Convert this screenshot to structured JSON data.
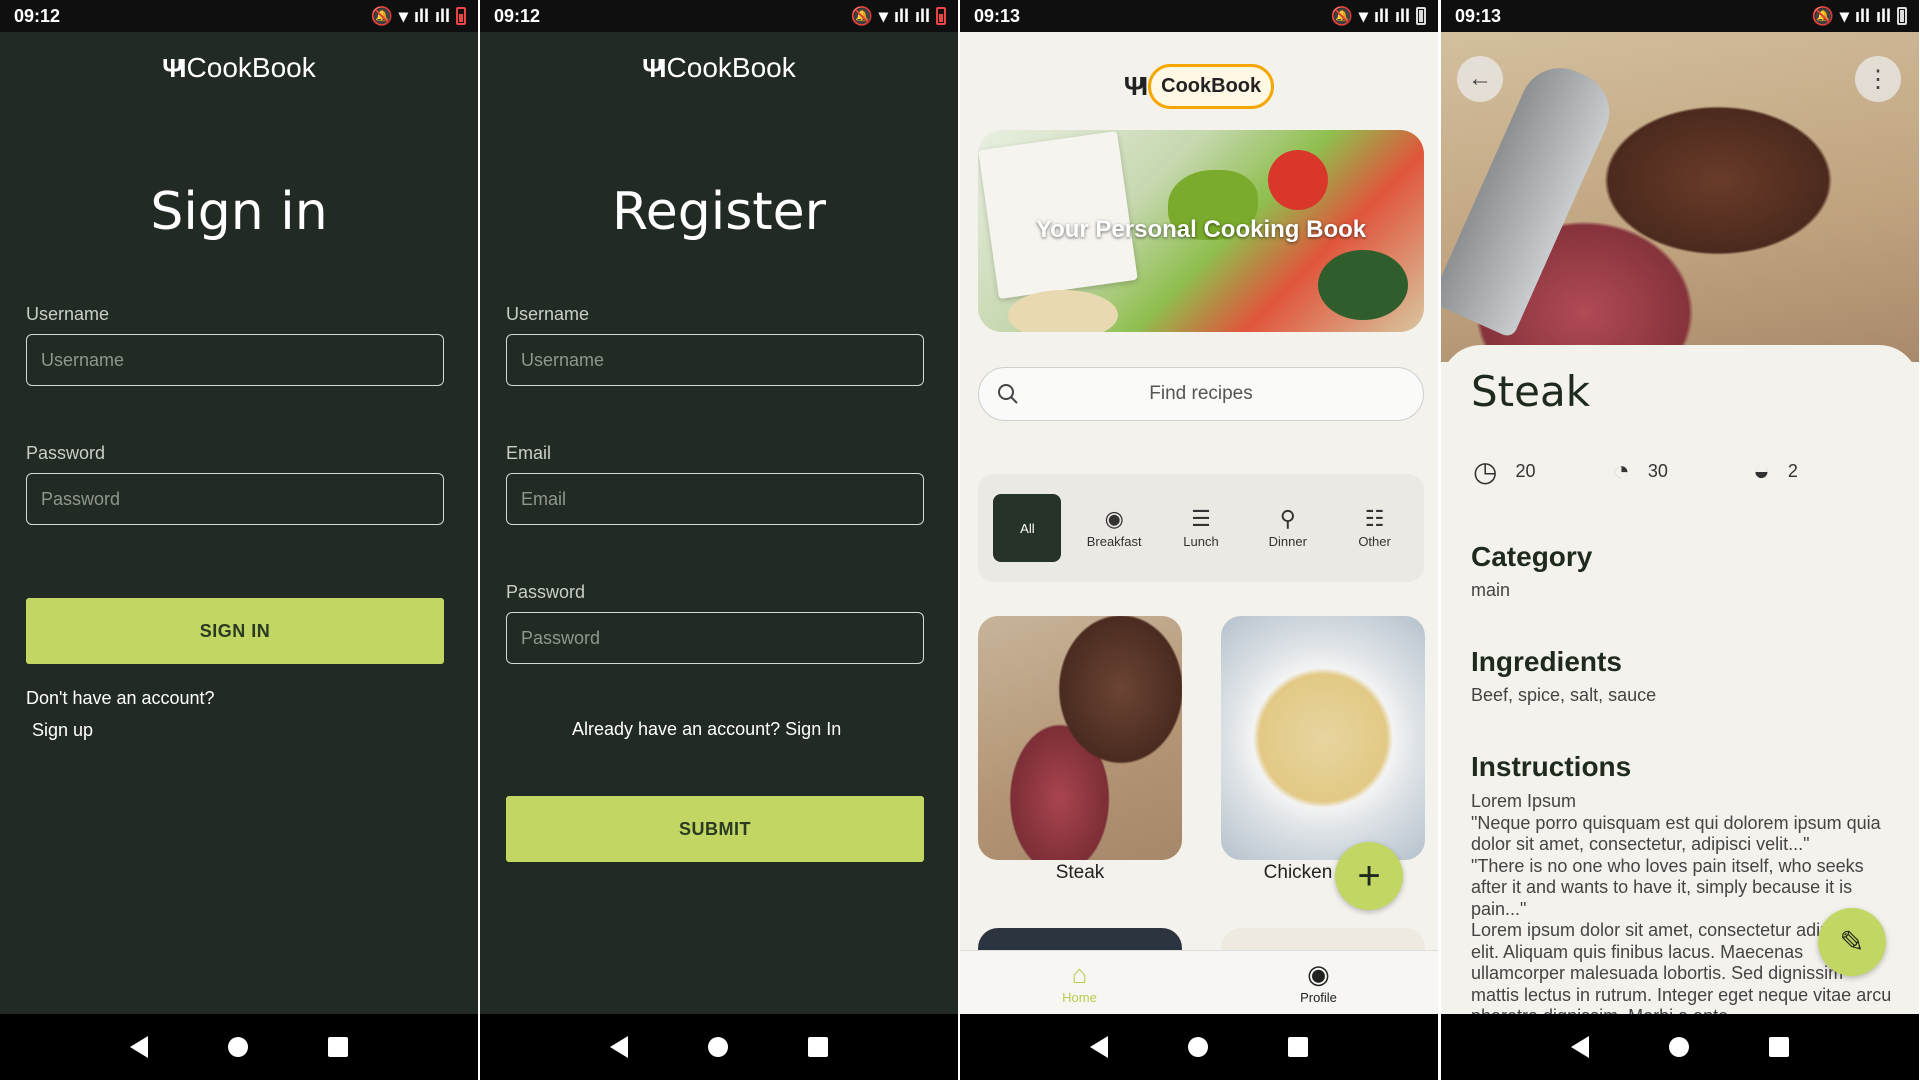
{
  "status": {
    "time_1": "09:12",
    "time_2": "09:12",
    "time_3": "09:13",
    "time_4": "09:13"
  },
  "app": {
    "name": "CookBook"
  },
  "signin": {
    "title": "Sign in",
    "username_label": "Username",
    "username_placeholder": "Username",
    "password_label": "Password",
    "password_placeholder": "Password",
    "button": "SIGN IN",
    "no_account": "Don't have an account?",
    "signup_link": "Sign up"
  },
  "register": {
    "title": "Register",
    "username_label": "Username",
    "username_placeholder": "Username",
    "email_label": "Email",
    "email_placeholder": "Email",
    "password_label": "Password",
    "password_placeholder": "Password",
    "have_account": "Already have an account?",
    "signin_link": "Sign In",
    "button": "SUBMIT"
  },
  "home": {
    "hero_text": "Your Personal Cooking Book",
    "search_placeholder": "Find recipes",
    "categories": [
      {
        "label": "All",
        "icon": "all"
      },
      {
        "label": "Breakfast",
        "icon": "breakfast-icon"
      },
      {
        "label": "Lunch",
        "icon": "lunch-icon"
      },
      {
        "label": "Dinner",
        "icon": "dinner-icon"
      },
      {
        "label": "Other",
        "icon": "other-icon"
      }
    ],
    "recipes": [
      {
        "name": "Steak"
      },
      {
        "name": "Chicken"
      }
    ],
    "nav": {
      "home": "Home",
      "profile": "Profile"
    }
  },
  "detail": {
    "title": "Steak",
    "prep_time": "20",
    "cook_time": "30",
    "servings": "2",
    "category_heading": "Category",
    "category_value": "main",
    "ingredients_heading": "Ingredients",
    "ingredients_value": "Beef, spice, salt, sauce",
    "instructions_heading": "Instructions",
    "instructions_value": "Lorem Ipsum\n\"Neque porro quisquam est qui dolorem ipsum quia dolor sit amet, consectetur, adipisci velit...\"\n\"There is no one who loves pain itself, who seeks after it and wants to have it, simply because it is pain...\"\nLorem ipsum dolor sit amet, consectetur adipiscing elit. Aliquam quis finibus lacus. Maecenas ullamcorper malesuada lobortis. Sed dignissim mattis lectus in rutrum. Integer eget neque vitae arcu pharetra dignissim. Morbi a ante"
  },
  "colors": {
    "dark_bg": "#222a24",
    "accent": "#c2d663",
    "light_bg": "#f4f2ec",
    "logo_ring": "#f5a700"
  }
}
